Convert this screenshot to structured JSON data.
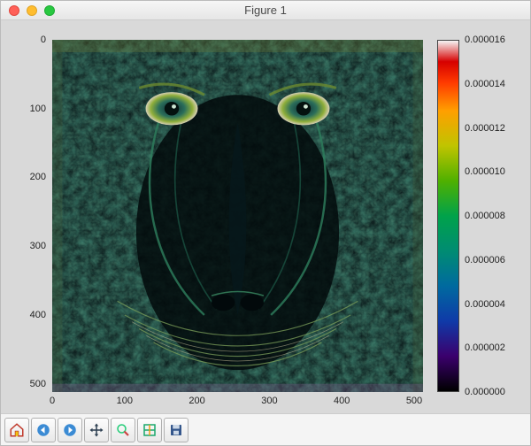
{
  "window": {
    "title": "Figure 1"
  },
  "chart_data": {
    "type": "heatmap",
    "description": "Edge-magnitude / gradient visualization of the 512×512 'mandrill' test image rendered with a dark-to-light multi-hue colormap (nipy_spectral style).",
    "image_subject": "mandrill (baboon) face",
    "grid_shape": [
      512,
      512
    ],
    "xlabel": "",
    "ylabel": "",
    "x_range": [
      0,
      512
    ],
    "y_range": [
      0,
      512
    ],
    "y_axis_inverted": true,
    "x_ticks": [
      0,
      100,
      200,
      300,
      400,
      500
    ],
    "y_ticks": [
      0,
      100,
      200,
      300,
      400,
      500
    ],
    "value_range": [
      0.0,
      1.6e-05
    ],
    "colorbar": {
      "ticks": [
        0.0,
        2e-06,
        4e-06,
        6e-06,
        8e-06,
        1e-05,
        1.2e-05,
        1.4e-05,
        1.6e-05
      ],
      "tick_labels": [
        "0.000000",
        "0.000002",
        "0.000004",
        "0.000006",
        "0.000008",
        "0.000010",
        "0.000012",
        "0.000014",
        "0.000016"
      ],
      "colormap": "nipy_spectral",
      "colormap_stops": [
        [
          0.0,
          "#000000"
        ],
        [
          0.1,
          "#3b006d"
        ],
        [
          0.2,
          "#0f3aa8"
        ],
        [
          0.3,
          "#006a9f"
        ],
        [
          0.4,
          "#008c72"
        ],
        [
          0.5,
          "#00a24a"
        ],
        [
          0.6,
          "#4fb000"
        ],
        [
          0.7,
          "#c0c400"
        ],
        [
          0.8,
          "#ff9f00"
        ],
        [
          0.88,
          "#ff3b00"
        ],
        [
          0.94,
          "#d60000"
        ],
        [
          1.0,
          "#f5f5f5"
        ]
      ]
    }
  },
  "axes": {
    "x": {
      "t0": "0",
      "t1": "100",
      "t2": "200",
      "t3": "300",
      "t4": "400",
      "t5": "500"
    },
    "y": {
      "t0": "0",
      "t1": "100",
      "t2": "200",
      "t3": "300",
      "t4": "400",
      "t5": "500"
    }
  },
  "cbar": {
    "l0": "0.000000",
    "l1": "0.000002",
    "l2": "0.000004",
    "l3": "0.000006",
    "l4": "0.000008",
    "l5": "0.000010",
    "l6": "0.000012",
    "l7": "0.000014",
    "l8": "0.000016"
  },
  "toolbar": {
    "home": "Home",
    "back": "Back",
    "forward": "Forward",
    "pan": "Pan",
    "zoom": "Zoom",
    "subplots": "Configure subplots",
    "save": "Save"
  }
}
